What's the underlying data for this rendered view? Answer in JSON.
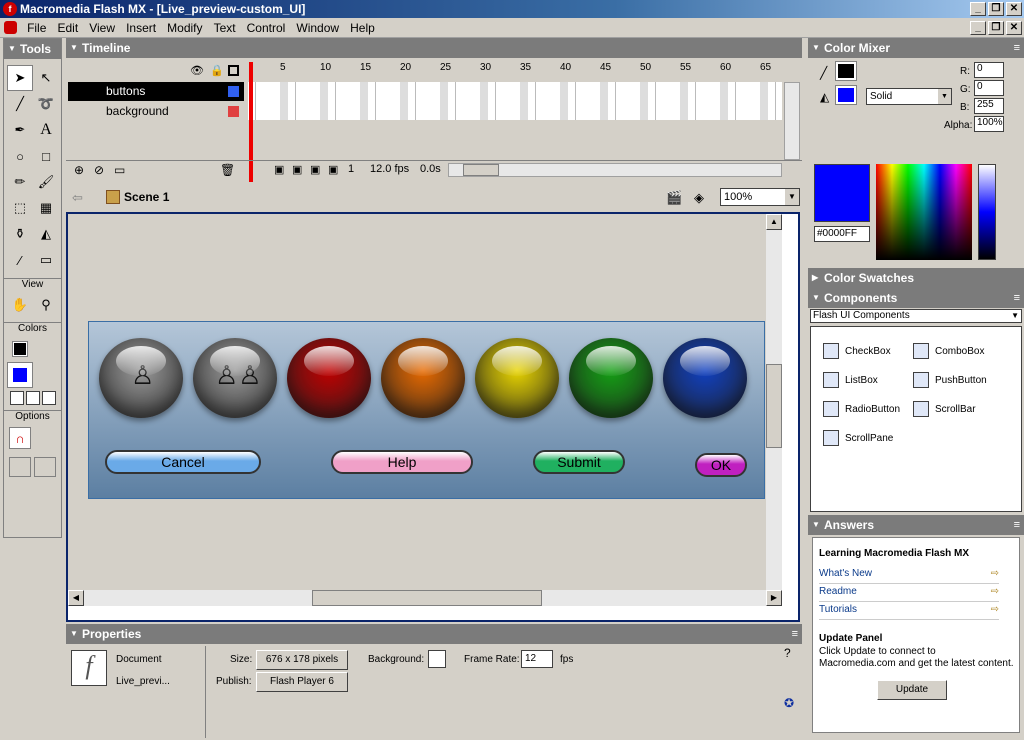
{
  "window": {
    "title": "Macromedia Flash MX - [Live_preview-custom_UI]"
  },
  "menu": [
    "File",
    "Edit",
    "View",
    "Insert",
    "Modify",
    "Text",
    "Control",
    "Window",
    "Help"
  ],
  "tools": {
    "title": "Tools",
    "view_label": "View",
    "colors_label": "Colors",
    "options_label": "Options"
  },
  "timeline": {
    "title": "Timeline",
    "ruler": [
      "5",
      "10",
      "15",
      "20",
      "25",
      "30",
      "35",
      "40",
      "45",
      "50",
      "55",
      "60",
      "65"
    ],
    "layers": [
      {
        "name": "buttons",
        "selected": true
      },
      {
        "name": "background",
        "selected": false
      }
    ],
    "frame": "1",
    "fps": "12.0 fps",
    "time": "0.0s"
  },
  "stage": {
    "scene": "Scene 1",
    "zoom": "100%"
  },
  "movie": {
    "orbs": [
      {
        "name": "orb-gray-one",
        "color": "#9a9a9a"
      },
      {
        "name": "orb-gray-two",
        "color": "#9a9a9a"
      },
      {
        "name": "orb-red",
        "color": "#c00000"
      },
      {
        "name": "orb-orange",
        "color": "#e86a00"
      },
      {
        "name": "orb-yellow",
        "color": "#e8d400"
      },
      {
        "name": "orb-green",
        "color": "#14a014"
      },
      {
        "name": "orb-blue",
        "color": "#1040c0"
      }
    ],
    "buttons": [
      {
        "label": "Cancel",
        "color": "#6aaae8"
      },
      {
        "label": "Help",
        "color": "#f0a0c8"
      },
      {
        "label": "Submit",
        "color": "#20b060"
      },
      {
        "label": "OK",
        "color": "#c020c0"
      }
    ]
  },
  "properties": {
    "title": "Properties",
    "doc_label": "Document",
    "doc_name": "Live_previ...",
    "size_label": "Size:",
    "size_value": "676 x 178 pixels",
    "publish_label": "Publish:",
    "publish_value": "Flash Player 6",
    "background_label": "Background:",
    "frame_rate_label": "Frame Rate:",
    "frame_rate_value": "12",
    "fps_label": "fps"
  },
  "color_mixer": {
    "title": "Color Mixer",
    "fill_type": "Solid",
    "r_label": "R:",
    "r": "0",
    "g_label": "G:",
    "g": "0",
    "b_label": "B:",
    "b": "255",
    "alpha_label": "Alpha:",
    "alpha": "100%",
    "hex": "#0000FF",
    "swatch": "#0000ff"
  },
  "color_swatches": {
    "title": "Color Swatches"
  },
  "components": {
    "title": "Components",
    "set": "Flash UI Components",
    "items": [
      "CheckBox",
      "ComboBox",
      "ListBox",
      "PushButton",
      "RadioButton",
      "ScrollBar",
      "ScrollPane"
    ]
  },
  "answers": {
    "title": "Answers",
    "heading": "Learning Macromedia Flash MX",
    "links": [
      "What's New",
      "Readme",
      "Tutorials"
    ],
    "update_heading": "Update Panel",
    "update_text": "Click Update to connect to Macromedia.com and get the latest content.",
    "update_button": "Update"
  }
}
